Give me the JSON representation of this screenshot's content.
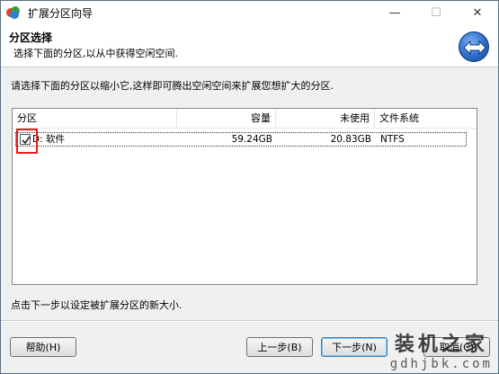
{
  "window": {
    "title": "扩展分区向导",
    "minimize_glyph": "—",
    "maximize_glyph": "☐",
    "close_glyph": "✕"
  },
  "header": {
    "title": "分区选择",
    "subtitle": "选择下面的分区,以从中获得空闲空间."
  },
  "instruction": "请选择下面的分区以缩小它,这样即可腾出空闲空间来扩展您想扩大的分区.",
  "table": {
    "columns": [
      "分区",
      "容量",
      "未使用",
      "文件系统"
    ],
    "rows": [
      {
        "checked": true,
        "name": "D: 软件",
        "capacity": "59.24GB",
        "unused": "20.83GB",
        "filesystem": "NTFS"
      }
    ]
  },
  "hint": "点击下一步以设定被扩展分区的新大小.",
  "buttons": {
    "help": "帮助(H)",
    "back": "上一步(B)",
    "next": "下一步(N)",
    "cancel": "取消(C)"
  },
  "watermark": {
    "line1": "装机之家",
    "line2": "gdhjbk.com"
  },
  "colors": {
    "highlight": "#e81c1c",
    "default_button_border": "#3c7fb1"
  }
}
